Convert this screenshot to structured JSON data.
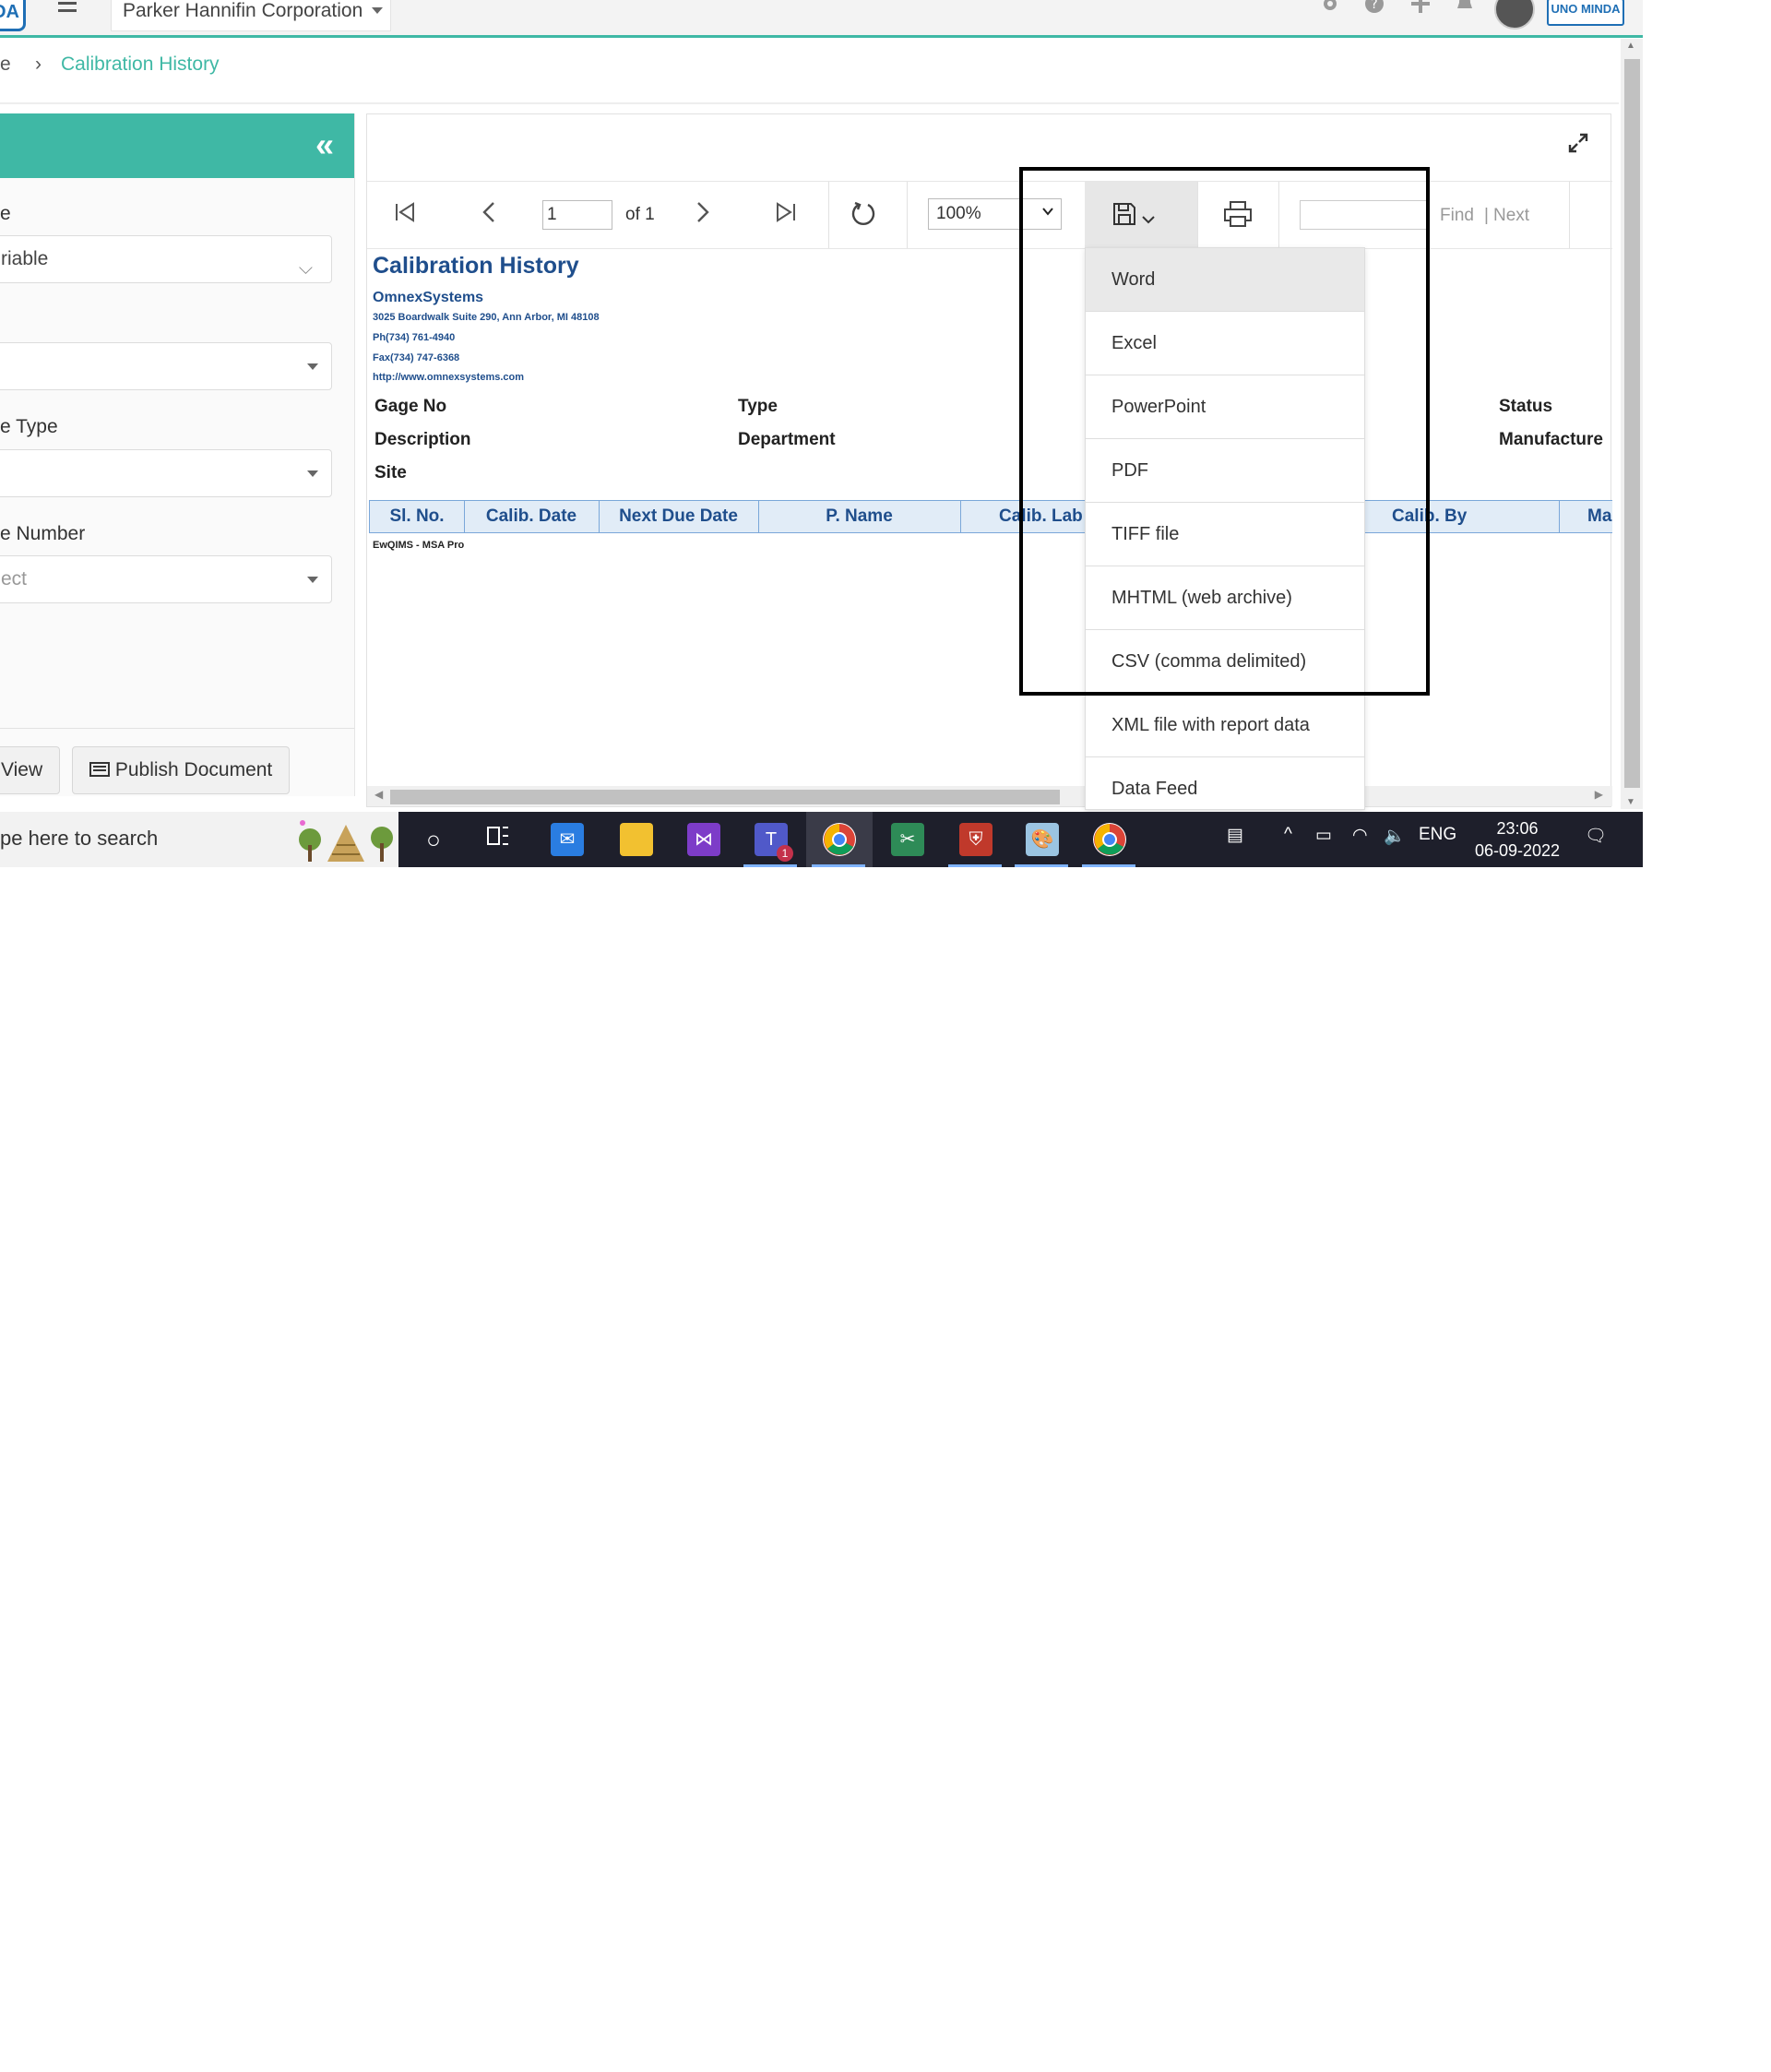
{
  "topnav": {
    "logo_text": "DA",
    "organization": "Parker Hannifin Corporation",
    "brand": "UNO MINDA"
  },
  "breadcrumb": {
    "previous": "e",
    "current": "Calibration History"
  },
  "filters": {
    "field1": {
      "label": "e",
      "value": "riable"
    },
    "field2": {
      "value": ""
    },
    "field3": {
      "label": "e Type",
      "value": ""
    },
    "field4": {
      "label": "e Number",
      "placeholder": "ect"
    }
  },
  "buttons": {
    "view": "View",
    "publish": "Publish Document"
  },
  "toolbar": {
    "page": "1",
    "of": "of 1",
    "zoom": "100%",
    "find": "Find",
    "pipe": "|",
    "next": "Next"
  },
  "report": {
    "title": "Calibration History",
    "company": "OmnexSystems",
    "address": "3025 Boardwalk Suite 290, Ann Arbor, MI 48108",
    "phone": "Ph(734) 761-4940",
    "fax": "Fax(734) 747-6368",
    "website": "http://www.omnexsystems.com",
    "fields": {
      "gage_no": "Gage No",
      "type": "Type",
      "status": "Status",
      "description": "Description",
      "department": "Department",
      "manufacturer": "Manufacture",
      "site": "Site"
    },
    "columns": [
      "Sl. No.",
      "Calib. Date",
      "Next Due Date",
      "P. Name",
      "Calib. Lab",
      "Calib. By",
      "Ma"
    ],
    "footer": "EwQIMS - MSA Pro"
  },
  "export_menu": {
    "items": [
      "Word",
      "Excel",
      "PowerPoint",
      "PDF",
      "TIFF file",
      "MHTML (web archive)",
      "CSV (comma delimited)",
      "XML file with report data",
      "Data Feed"
    ]
  },
  "taskbar": {
    "search": "pe here to search",
    "language": "ENG",
    "time": "23:06",
    "date": "06-09-2022",
    "teams_badge": "1"
  },
  "colors": {
    "accent": "#3fb8a5",
    "report_blue": "#1f4e8c",
    "grid_header_bg": "#e1ecf7"
  }
}
